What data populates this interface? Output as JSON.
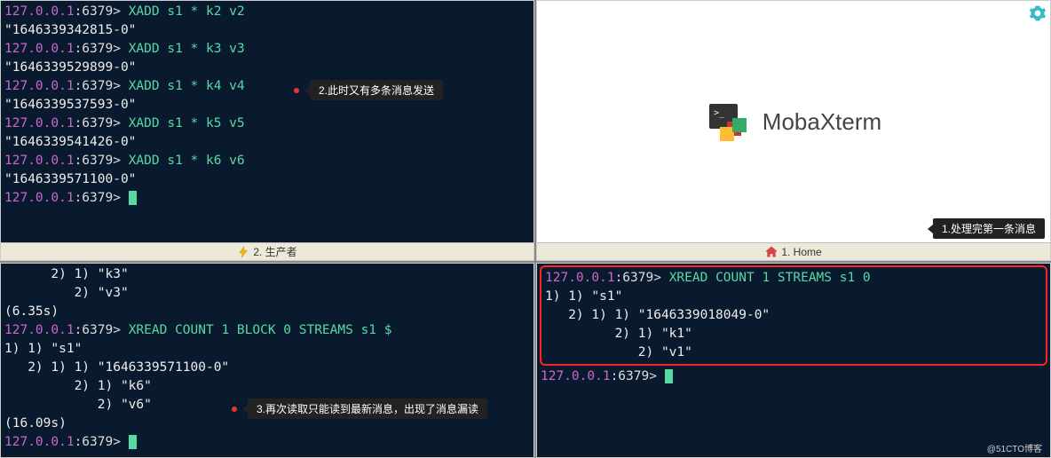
{
  "panes": {
    "tl": {
      "tab_label": "2. 生产者",
      "lines": [
        {
          "t": "prompt",
          "host": "127.0.0.1",
          "port": ":6379> ",
          "cmd": "XADD s1 * k2 v2"
        },
        {
          "t": "out",
          "text": "\"1646339342815-0\""
        },
        {
          "t": "prompt",
          "host": "127.0.0.1",
          "port": ":6379> ",
          "cmd": "XADD s1 * k3 v3"
        },
        {
          "t": "out",
          "text": "\"1646339529899-0\""
        },
        {
          "t": "prompt",
          "host": "127.0.0.1",
          "port": ":6379> ",
          "cmd": "XADD s1 * k4 v4"
        },
        {
          "t": "out",
          "text": "\"1646339537593-0\""
        },
        {
          "t": "prompt",
          "host": "127.0.0.1",
          "port": ":6379> ",
          "cmd": "XADD s1 * k5 v5"
        },
        {
          "t": "out",
          "text": "\"1646339541426-0\""
        },
        {
          "t": "prompt",
          "host": "127.0.0.1",
          "port": ":6379> ",
          "cmd": "XADD s1 * k6 v6"
        },
        {
          "t": "out",
          "text": "\"1646339571100-0\""
        },
        {
          "t": "prompt",
          "host": "127.0.0.1",
          "port": ":6379> ",
          "cursor": true
        }
      ]
    },
    "tr": {
      "tab_label": "1. Home",
      "app_name": "MobaXterm"
    },
    "bl": {
      "lines": [
        {
          "t": "out",
          "text": "      2) 1) \"k3\""
        },
        {
          "t": "out",
          "text": "         2) \"v3\""
        },
        {
          "t": "out",
          "text": "(6.35s)"
        },
        {
          "t": "prompt",
          "host": "127.0.0.1",
          "port": ":6379> ",
          "cmd": "XREAD COUNT 1 BLOCK 0 STREAMS s1 $"
        },
        {
          "t": "out",
          "text": "1) 1) \"s1\""
        },
        {
          "t": "out",
          "text": "   2) 1) 1) \"1646339571100-0\""
        },
        {
          "t": "out",
          "text": "         2) 1) \"k6\""
        },
        {
          "t": "out",
          "text": "            2) \"v6\""
        },
        {
          "t": "out",
          "text": "(16.09s)"
        },
        {
          "t": "prompt",
          "host": "127.0.0.1",
          "port": ":6379> ",
          "cursor": true
        }
      ]
    },
    "br": {
      "box_lines": [
        {
          "t": "prompt",
          "host": "127.0.0.1",
          "port": ":6379> ",
          "cmd": "XREAD COUNT 1 STREAMS s1 0"
        },
        {
          "t": "out",
          "text": "1) 1) \"s1\""
        },
        {
          "t": "out",
          "text": "   2) 1) 1) \"1646339018049-0\""
        },
        {
          "t": "out",
          "text": "         2) 1) \"k1\""
        },
        {
          "t": "out",
          "text": "            2) \"v1\""
        }
      ],
      "after_lines": [
        {
          "t": "prompt",
          "host": "127.0.0.1",
          "port": ":6379> ",
          "cursor": true
        }
      ]
    }
  },
  "annotations": {
    "a1": "1.处理完第一条消息",
    "a2": "2.此时又有多条消息发送",
    "a3": "3.再次读取只能读到最新消息，出现了消息漏读"
  },
  "watermark": "@51CTO博客"
}
